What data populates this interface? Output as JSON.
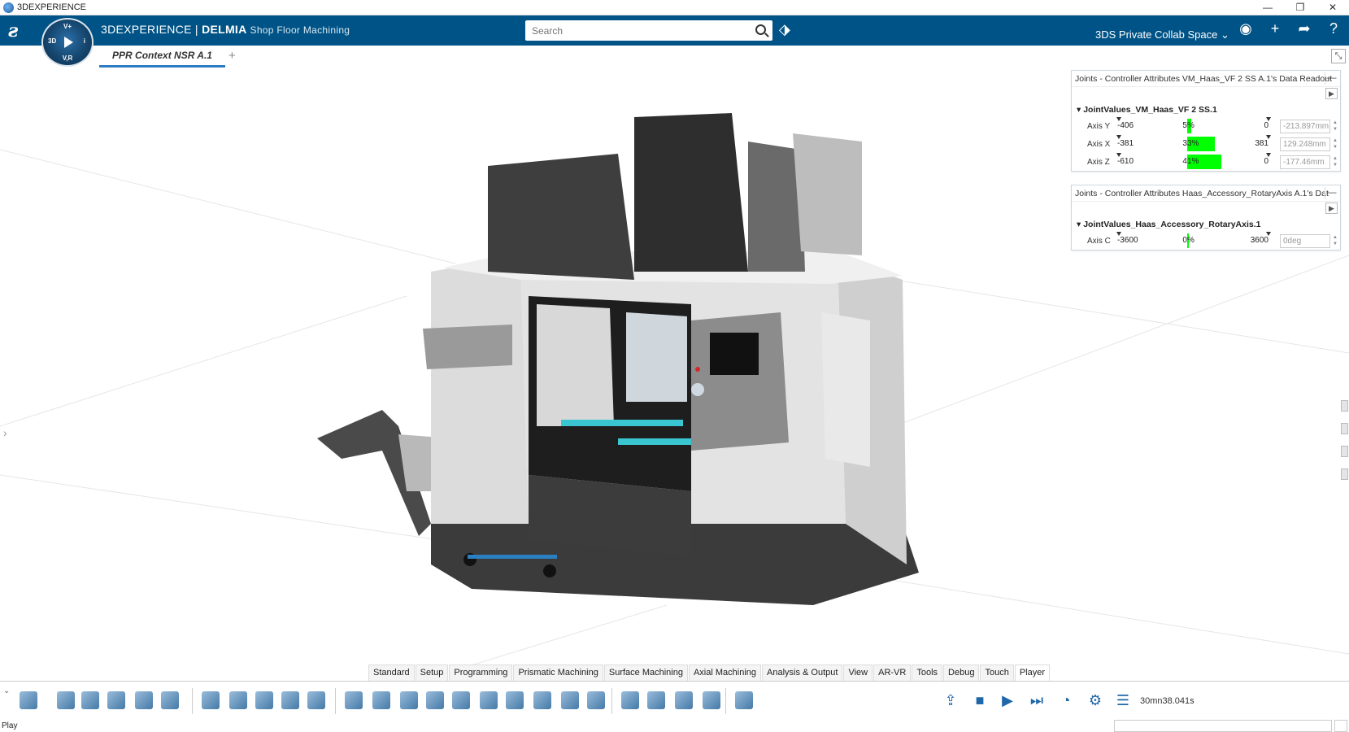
{
  "window": {
    "title": "3DEXPERIENCE",
    "controls": [
      "—",
      "❐",
      "✕"
    ]
  },
  "topbar": {
    "brand_prefix": "3DEXPERIENCE | ",
    "brand_main": "DELMIA",
    "app_name": "Shop Floor Machining",
    "search_placeholder": "Search",
    "collab_space": "3DS Private Collab Space",
    "compass_labels": {
      "top": "V+",
      "left": "3D",
      "right": "i",
      "bottom": "V,R"
    }
  },
  "tabs": {
    "active": "PPR Context NSR A.1",
    "add": "+"
  },
  "panels": [
    {
      "header": "Joints - Controller Attributes VM_Haas_VF 2 SS A.1's Data Readout",
      "group": "JointValues_VM_Haas_VF 2 SS.1",
      "axes": [
        {
          "name": "Axis Y",
          "min": "-406",
          "max": "0",
          "pct_label": "5%",
          "level": 0.05,
          "value": "-213.897mm"
        },
        {
          "name": "Axis X",
          "min": "-381",
          "max": "381",
          "pct_label": "33%",
          "level": 0.33,
          "value": "129.248mm"
        },
        {
          "name": "Axis Z",
          "min": "-610",
          "max": "0",
          "pct_label": "41%",
          "level": 0.41,
          "value": "-177.46mm"
        }
      ]
    },
    {
      "header": "Joints - Controller Attributes Haas_Accessory_RotaryAxis A.1's Dat",
      "group": "JointValues_Haas_Accessory_RotaryAxis.1",
      "axes": [
        {
          "name": "Axis C",
          "min": "-3600",
          "max": "3600",
          "pct_label": "0%",
          "level": 0.0,
          "value": "0deg"
        }
      ]
    }
  ],
  "command_tabs": [
    "Standard",
    "Setup",
    "Programming",
    "Prismatic Machining",
    "Surface Machining",
    "Axial Machining",
    "Analysis & Output",
    "View",
    "AR-VR",
    "Tools",
    "Debug",
    "Touch",
    "Player"
  ],
  "active_command_tab": "Player",
  "player": {
    "time": "30mn38.041s"
  },
  "status": {
    "text": "Play"
  },
  "colors": {
    "topbar": "#005386",
    "accent": "#2b7cc2",
    "readout_fill": "#00ff00"
  }
}
